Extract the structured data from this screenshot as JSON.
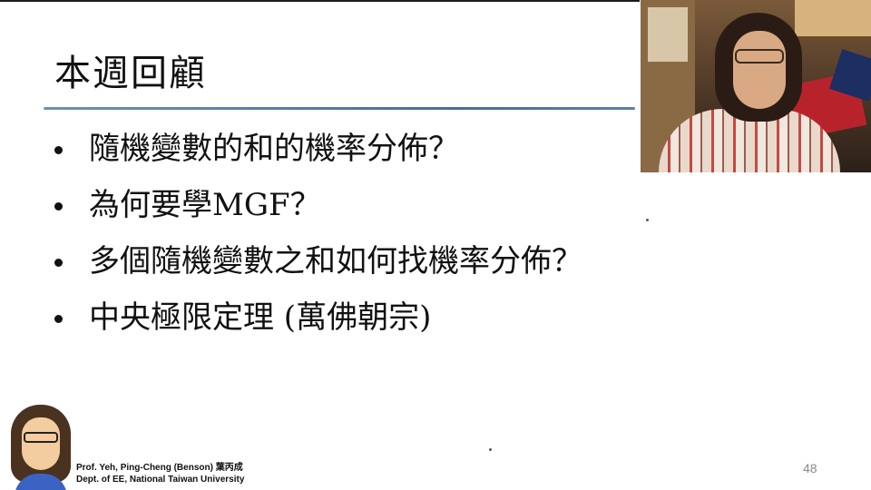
{
  "slide": {
    "title": "本週回顧",
    "bullets": [
      "隨機變數的和的機率分佈？",
      "為何要學MGF？",
      "多個隨機變數之和如何找機率分佈？",
      "中央極限定理 (萬佛朝宗)"
    ],
    "page_number": "48"
  },
  "credit": {
    "line1": "Prof. Yeh, Ping-Cheng (Benson) 葉丙成",
    "line2": "Dept. of EE,  National Taiwan University"
  },
  "colors": {
    "title_rule": "#4a6d9a",
    "text": "#111111",
    "page_number": "#8a8a8a"
  }
}
